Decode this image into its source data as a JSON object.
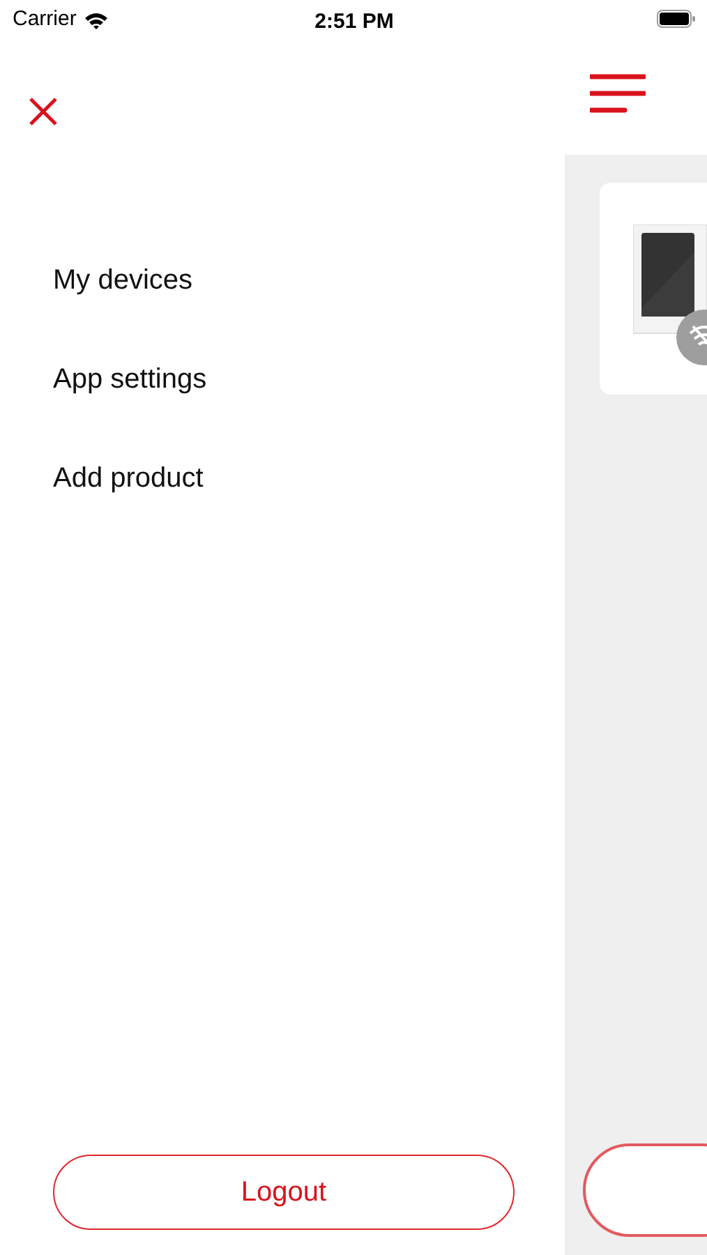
{
  "status_bar": {
    "carrier": "Carrier",
    "time": "2:51 PM"
  },
  "menu": {
    "items": [
      {
        "label": "My devices"
      },
      {
        "label": "App settings"
      },
      {
        "label": "Add product"
      }
    ],
    "logout_button": "Logout"
  }
}
